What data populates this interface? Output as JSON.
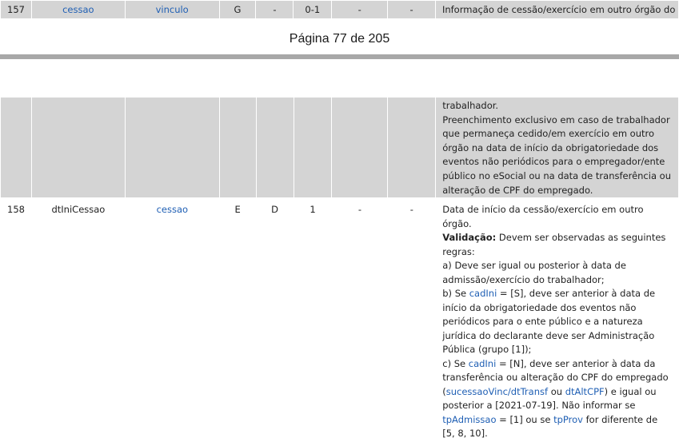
{
  "row157": {
    "num": "157",
    "name": "cessao",
    "parent": "vinculo",
    "type": "G",
    "elem": "-",
    "occ": "0-1",
    "size": "-",
    "dec": "-",
    "desc": "Informação de cessão/exercício em outro órgão do"
  },
  "page": {
    "label": "Página 77 de 205"
  },
  "cont": {
    "line1": "trabalhador.",
    "line2": "Preenchimento exclusivo em caso de trabalhador que permaneça cedido/em exercício em outro órgão na data de início da obrigatoriedade dos eventos não periódicos para o empregador/ente público no eSocial ou na data de transferência ou alteração de CPF do empregado."
  },
  "row158": {
    "num": "158",
    "name": "dtIniCessao",
    "parent": "cessao",
    "type": "E",
    "elem": "D",
    "occ": "1",
    "size": "-",
    "dec": "-",
    "desc_intro": "Data de início da cessão/exercício em outro órgão.",
    "val_label": "Validação:",
    "val_text": " Devem ser observadas as seguintes regras:",
    "rule_a": "a) Deve ser igual ou posterior à data de admissão/exercício do trabalhador;",
    "rule_b_pre": "b) Se ",
    "rule_b_link": "cadIni",
    "rule_b_post": " = [S], deve ser anterior à data de início da obrigatoriedade dos eventos não periódicos para o ente público e a natureza jurídica do declarante deve ser Administração Pública (grupo [1]);",
    "rule_c_pre": "c) Se ",
    "rule_c_link1": "cadIni",
    "rule_c_mid1": " = [N], deve ser anterior à data da transferência ou alteração do CPF do empregado (",
    "rule_c_link2": "sucessaoVinc/dtTransf",
    "rule_c_mid2": " ou ",
    "rule_c_link3": "dtAltCPF",
    "rule_c_mid3": ") e igual ou posterior a [2021-07-19]. Não informar se ",
    "rule_c_link4": "tpAdmissao",
    "rule_c_mid4": " = [1] ou se ",
    "rule_c_link5": "tpProv",
    "rule_c_end": " for diferente de [5, 8, 10]."
  }
}
